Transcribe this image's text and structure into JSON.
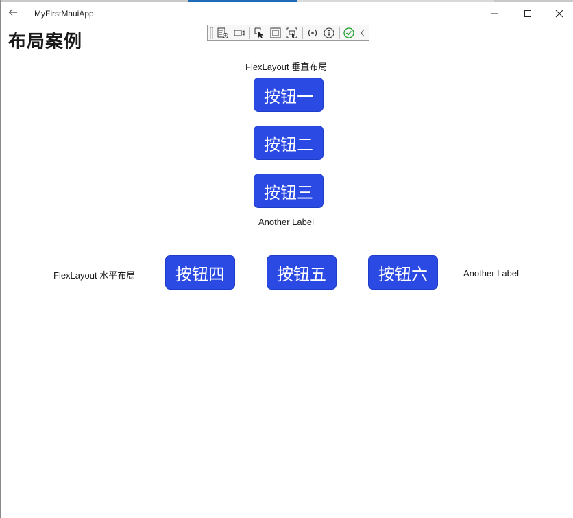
{
  "window": {
    "app_title": "MyFirstMauiApp"
  },
  "page": {
    "title": "布局案例"
  },
  "vertical_layout": {
    "header_label": "FlexLayout 垂直布局",
    "buttons": [
      "按钮一",
      "按钮二",
      "按钮三"
    ],
    "footer_label": "Another Label"
  },
  "horizontal_layout": {
    "header_label": "FlexLayout 水平布局",
    "buttons": [
      "按钮四",
      "按钮五",
      "按钮六"
    ],
    "footer_label": "Another Label"
  },
  "toolbar": {
    "icons": [
      "live-visual-tree-icon",
      "record-icon",
      "select-element-icon",
      "display-layout-adorners-icon",
      "track-focus-icon",
      "binding-failures-icon",
      "accessibility-checker-icon",
      "hot-reload-status-icon",
      "collapse-toolbar-icon"
    ]
  },
  "colors": {
    "button_bg": "#2b4ae3",
    "button_text": "#ffffff",
    "hot_reload_ok": "#1a9e2a"
  }
}
